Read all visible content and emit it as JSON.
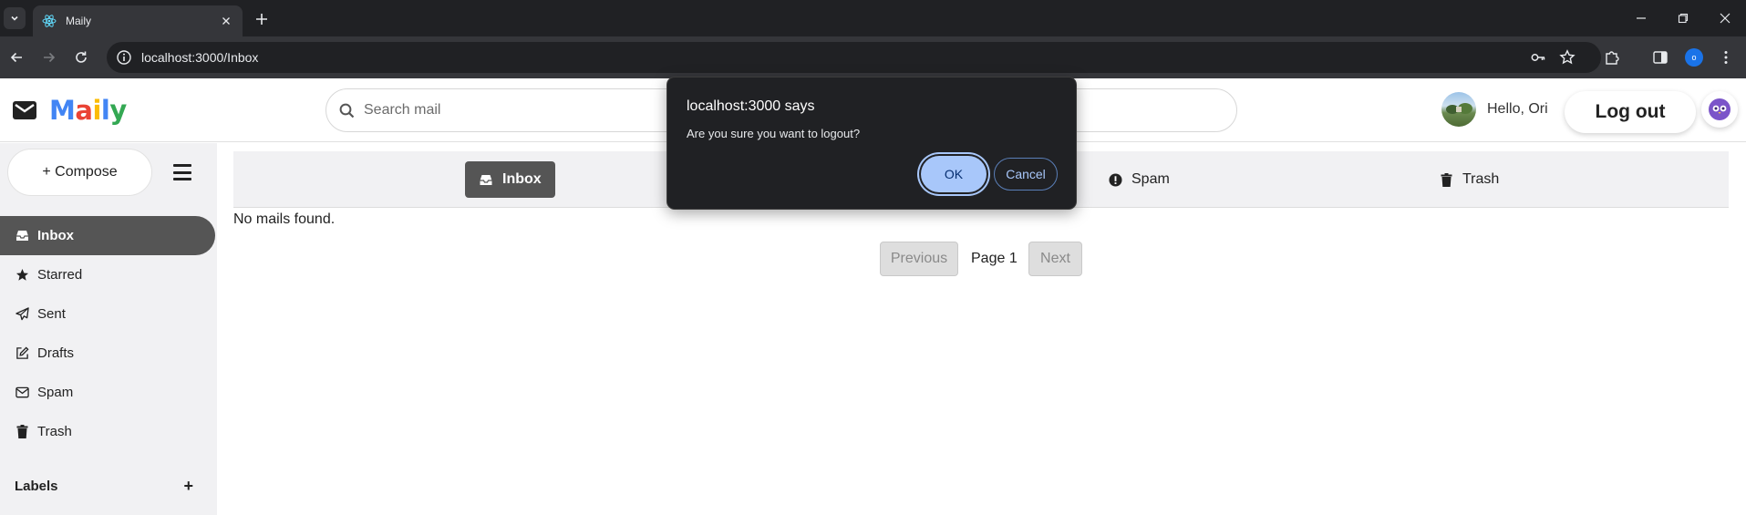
{
  "browser": {
    "tab_title": "Maily",
    "url": "localhost:3000/Inbox",
    "profile_initial": "o"
  },
  "app": {
    "logo": {
      "letters": [
        "M",
        "a",
        "i",
        "l",
        "y"
      ],
      "colors": [
        "#4285F4",
        "#EA4335",
        "#FBBC05",
        "#4285F4",
        "#34A853"
      ]
    },
    "search_placeholder": "Search mail",
    "greeting": "Hello, Ori",
    "logout_label": "Log out"
  },
  "sidebar": {
    "compose_label": "+ Compose",
    "items": [
      {
        "label": "Inbox",
        "icon": "inbox-icon",
        "active": true
      },
      {
        "label": "Starred",
        "icon": "star-icon"
      },
      {
        "label": "Sent",
        "icon": "paper-plane-icon"
      },
      {
        "label": "Drafts",
        "icon": "edit-icon"
      },
      {
        "label": "Spam",
        "icon": "envelope-icon"
      },
      {
        "label": "Trash",
        "icon": "trash-icon"
      }
    ],
    "labels_title": "Labels",
    "labels_add": "+"
  },
  "main": {
    "categories": [
      {
        "label": "Inbox",
        "icon": "inbox-icon",
        "active": true
      },
      {
        "label": "Spam",
        "icon": "exclamation-circle-icon"
      },
      {
        "label": "Trash",
        "icon": "trash-icon"
      }
    ],
    "empty_message": "No mails found.",
    "pagination": {
      "previous": "Previous",
      "page_label": "Page 1",
      "next": "Next"
    }
  },
  "dialog": {
    "title": "localhost:3000 says",
    "message": "Are you sure you want to logout?",
    "ok": "OK",
    "cancel": "Cancel",
    "accent": "#a8c7fa"
  }
}
